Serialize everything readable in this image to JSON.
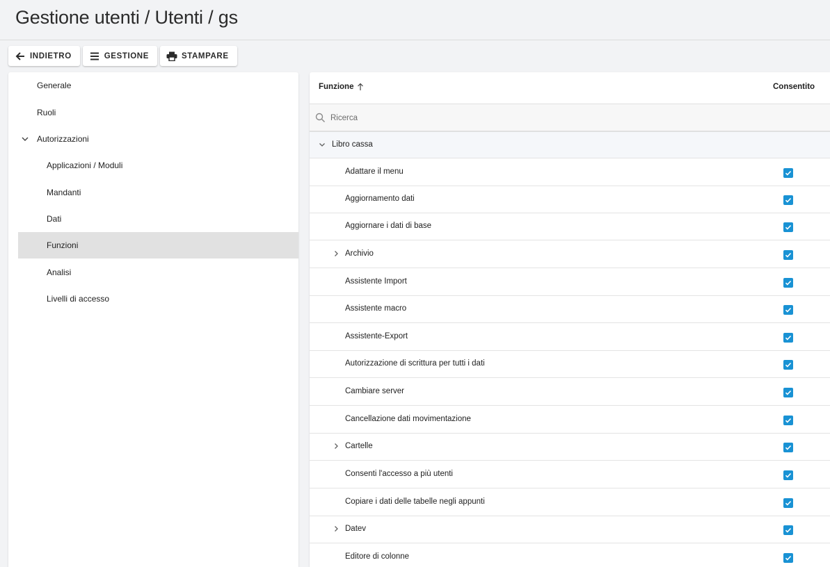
{
  "header": {
    "title": "Gestione utenti / Utenti / gs"
  },
  "toolbar": {
    "back_label": "INDIETRO",
    "manage_label": "GESTIONE",
    "print_label": "STAMPARE"
  },
  "sidebar": {
    "items": [
      {
        "label": "Generale"
      },
      {
        "label": "Ruoli"
      },
      {
        "label": "Autorizzazioni"
      },
      {
        "label": "Applicazioni / Moduli"
      },
      {
        "label": "Mandanti"
      },
      {
        "label": "Dati"
      },
      {
        "label": "Funzioni"
      },
      {
        "label": "Analisi"
      },
      {
        "label": "Livelli di accesso"
      }
    ]
  },
  "grid": {
    "col_function": "Funzione",
    "col_allowed": "Consentito",
    "search_placeholder": "Ricerca",
    "group": "Libro cassa",
    "rows": [
      {
        "label": "Adattare il menu",
        "allowed": true
      },
      {
        "label": "Aggiornamento dati",
        "allowed": true
      },
      {
        "label": "Aggiornare i dati di base",
        "allowed": true
      },
      {
        "label": "Archivio",
        "allowed": true
      },
      {
        "label": "Assistente Import",
        "allowed": true
      },
      {
        "label": "Assistente macro",
        "allowed": true
      },
      {
        "label": "Assistente-Export",
        "allowed": true
      },
      {
        "label": "Autorizzazione di scrittura per tutti i dati",
        "allowed": true
      },
      {
        "label": "Cambiare server",
        "allowed": true
      },
      {
        "label": "Cancellazione dati movimentazione",
        "allowed": true
      },
      {
        "label": "Cartelle",
        "allowed": true
      },
      {
        "label": "Consenti l'accesso a più utenti",
        "allowed": true
      },
      {
        "label": "Copiare i dati delle tabelle negli appunti",
        "allowed": true
      },
      {
        "label": "Datev",
        "allowed": true
      },
      {
        "label": "Editore di colonne",
        "allowed": true
      }
    ]
  },
  "colors": {
    "accent": "#1992d4",
    "selected_bg": "#e1e1e1",
    "page_bg": "#f2f3f5"
  }
}
